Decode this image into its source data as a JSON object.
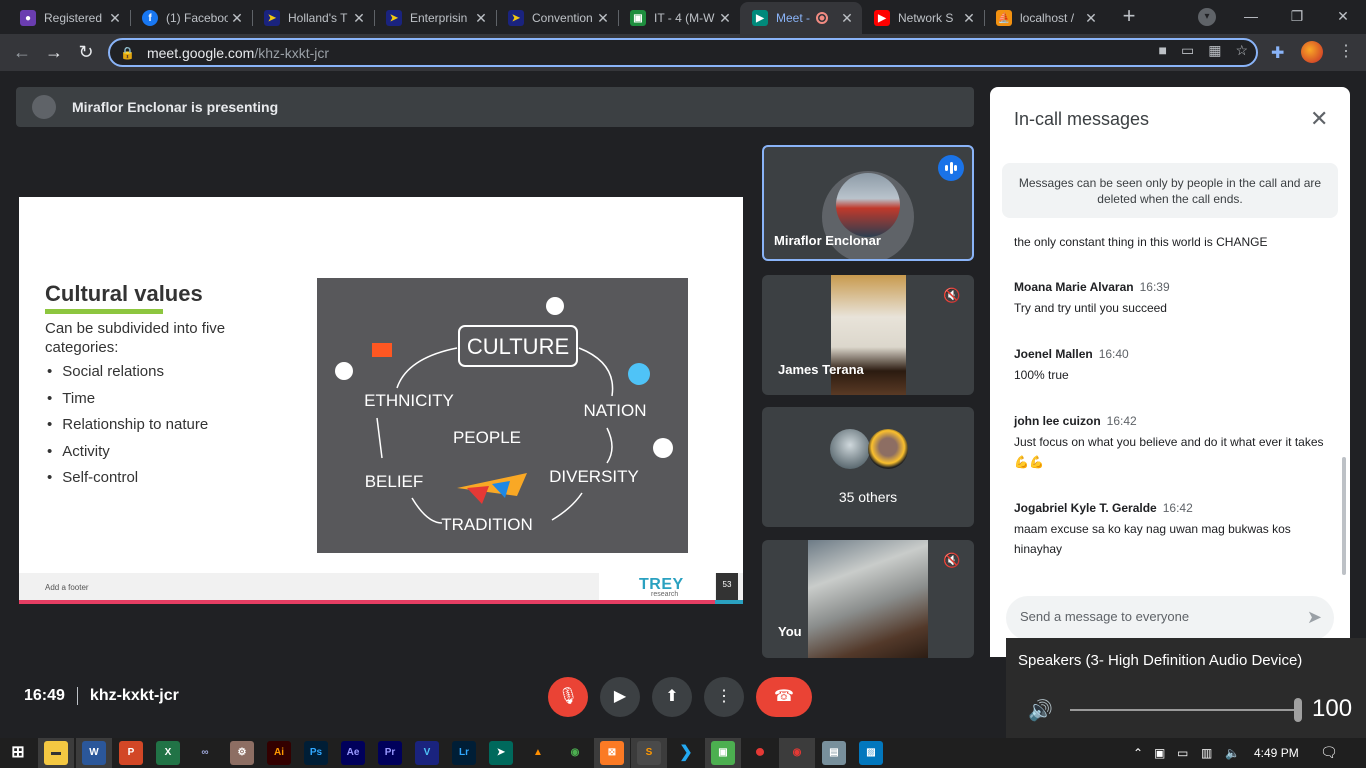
{
  "browser": {
    "tabs": [
      {
        "title": "Registered",
        "icon": "globe-icon",
        "color": "#b06cf0"
      },
      {
        "title": "(1) Facebook",
        "icon": "facebook-icon",
        "color": "#1877f2"
      },
      {
        "title": "Holland's T",
        "icon": "arrow-icon",
        "color": "#f2c80f"
      },
      {
        "title": "Enterprisin",
        "icon": "arrow-icon",
        "color": "#f2c80f"
      },
      {
        "title": "Convention",
        "icon": "arrow-icon",
        "color": "#f2c80f"
      },
      {
        "title": "IT - 4 (M-W",
        "icon": "classroom-icon",
        "color": "#1e8e3e"
      },
      {
        "title": "Meet -",
        "icon": "meet-icon",
        "color": "#00897b"
      },
      {
        "title": "Network S",
        "icon": "youtube-icon",
        "color": "#ff0000"
      },
      {
        "title": "localhost /",
        "icon": "phpmyadmin-icon",
        "color": "#f29111"
      }
    ],
    "url_host": "meet.google.com",
    "url_path": "/khz-kxkt-jcr"
  },
  "meet": {
    "presenting_text": "Miraflor Enclonar is presenting",
    "meeting_code": "khz-kxkt-jcr",
    "clock": "16:49",
    "participants": [
      {
        "name": "Miraflor Enclonar"
      },
      {
        "name": "James Terana"
      },
      {
        "name": "35 others"
      },
      {
        "name": "You"
      }
    ]
  },
  "slide": {
    "title": "Cultural values",
    "subtitle": "Can be subdivided into five categories:",
    "bullets": [
      "Social relations",
      "Time",
      "Relationship to nature",
      "Activity",
      "Self-control"
    ],
    "image_words": [
      "CULTURE",
      "ETHNICITY",
      "PEOPLE",
      "NATION",
      "BELIEF",
      "DIVERSITY",
      "TRADITION"
    ],
    "footer": "Add a footer",
    "logo": "TREY",
    "logo_sub": "research",
    "page_number": "53"
  },
  "chat": {
    "title": "In-call messages",
    "notice": "Messages can be seen only by people in the call and are deleted when the call ends.",
    "first_line": "the only constant thing in this world is CHANGE",
    "messages": [
      {
        "sender": "Moana Marie Alvaran",
        "time": "16:39",
        "text": "Try and try until you succeed"
      },
      {
        "sender": "Joenel Mallen",
        "time": "16:40",
        "text": "100% true"
      },
      {
        "sender": "john lee cuizon",
        "time": "16:42",
        "text": "Just focus on what you believe and do it what ever it takes 💪💪"
      },
      {
        "sender": "Jogabriel Kyle T. Geralde",
        "time": "16:42",
        "text": "maam excuse sa ko kay nag uwan mag bukwas kos hinayhay"
      }
    ],
    "input_placeholder": "Send a message to everyone"
  },
  "volume": {
    "device": "Speakers (3- High Definition Audio Device)",
    "level": "100"
  },
  "taskbar": {
    "time": "4:49 PM"
  },
  "colors": {
    "accent": "#1a73e8",
    "danger": "#ea4335"
  }
}
